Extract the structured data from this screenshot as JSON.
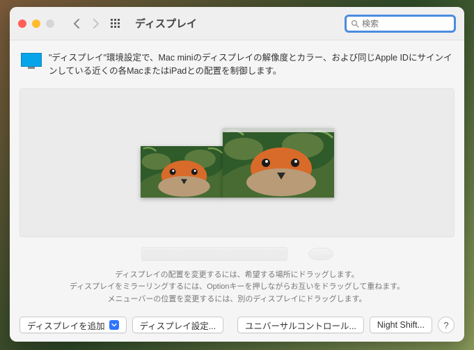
{
  "window": {
    "title": "ディスプレイ"
  },
  "search": {
    "placeholder": "検索"
  },
  "info": {
    "text": "\"ディスプレイ\"環境設定で、Mac miniのディスプレイの解像度とカラー、および同じApple IDにサインインしている近くの各MacまたはiPadとの配置を制御します。"
  },
  "hints": {
    "line1": "ディスプレイの配置を変更するには、希望する場所にドラッグします。",
    "line2": "ディスプレイをミラーリングするには、Optionキーを押しながらお互いをドラッグして重ねます。",
    "line3": "メニューバーの位置を変更するには、別のディスプレイにドラッグします。"
  },
  "footer": {
    "add_display": "ディスプレイを追加",
    "display_settings": "ディスプレイ設定...",
    "universal_control": "ユニバーサルコントロール...",
    "night_shift": "Night Shift...",
    "help": "?"
  }
}
